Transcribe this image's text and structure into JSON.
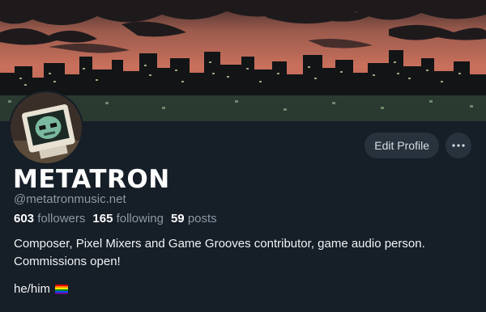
{
  "profile": {
    "display_name": "METATRON",
    "handle": "@metatronmusic.net",
    "followers_count": "603",
    "followers_label": "followers",
    "following_count": "165",
    "following_label": "following",
    "posts_count": "59",
    "posts_label": "posts",
    "bio_line1": "Composer, Pixel Mixers and Game Grooves contributor, game audio person.",
    "bio_line2": "Commissions open!",
    "pronouns": "he/him"
  },
  "actions": {
    "edit_profile_label": "Edit Profile",
    "more_icon": "ellipsis-icon"
  },
  "icons": {
    "pride_flag": "pride-flag-icon"
  },
  "colors": {
    "background": "#161e27",
    "button_bg": "#28323d",
    "muted_text": "#8c99a6",
    "banner_sky": "#c9705c"
  }
}
